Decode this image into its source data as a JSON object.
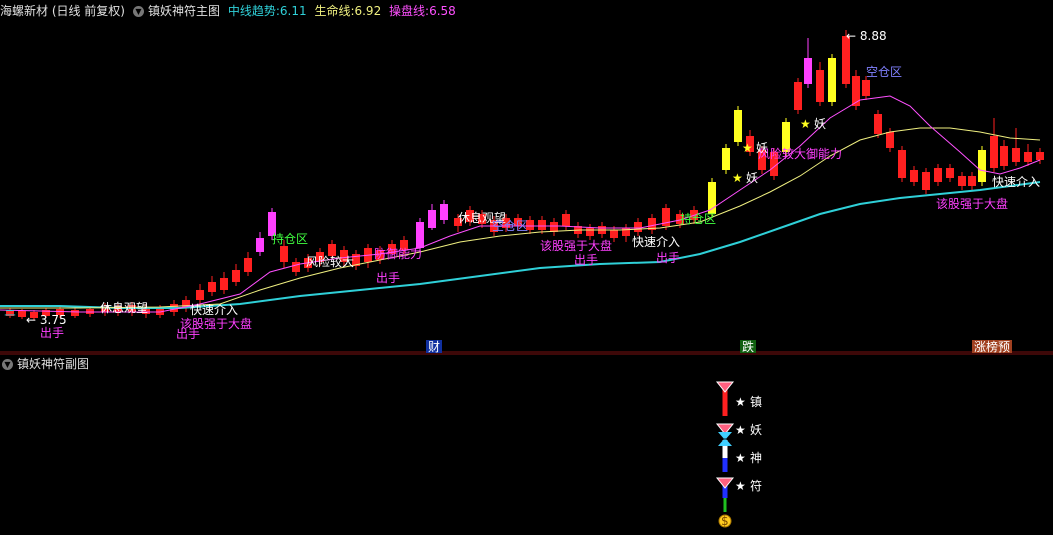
{
  "header": {
    "stock_title": "海螺新材 (日线 前复权)",
    "indicator_name": "镇妖神符主图",
    "mid_trend_label": "中线趋势:",
    "mid_trend_value": "6.11",
    "life_line_label": "生命线:",
    "life_line_value": "6.92",
    "control_line_label": "操盘线:",
    "control_line_value": "6.58"
  },
  "sub_header": {
    "indicator_name": "镇妖神符副图"
  },
  "colors": {
    "mid_trend": "#2fd0d8",
    "life_line": "#f0f080",
    "control_line": "#ff50ff",
    "up": "#ff2020",
    "magenta_candle": "#ff40ff",
    "yellow_candle": "#ffff20",
    "green_text": "#40ff40",
    "white_text": "#ffffff",
    "magenta_text": "#ff40ff",
    "blue_text": "#8080ff"
  },
  "price_marks": {
    "low": "3.75",
    "high": "8.88"
  },
  "signals": {
    "exit": "出手",
    "fast_entry": "快速介入",
    "stronger_than_market": "该股强于大盘",
    "wait_and_see": "休息观望",
    "hold_zone": "持仓区",
    "empty_zone": "空仓区",
    "high_risk": "风险较大",
    "strong_defense": "防御能力",
    "demon": "妖",
    "high_risk_defense": "风险较大御能力"
  },
  "bottom_tags": {
    "wealth": "财",
    "fall": "跌",
    "limit_up_warn": "涨榜预"
  },
  "sub_panel": {
    "zhen": "镇",
    "yao": "妖",
    "shen": "神",
    "fu": "符"
  }
}
